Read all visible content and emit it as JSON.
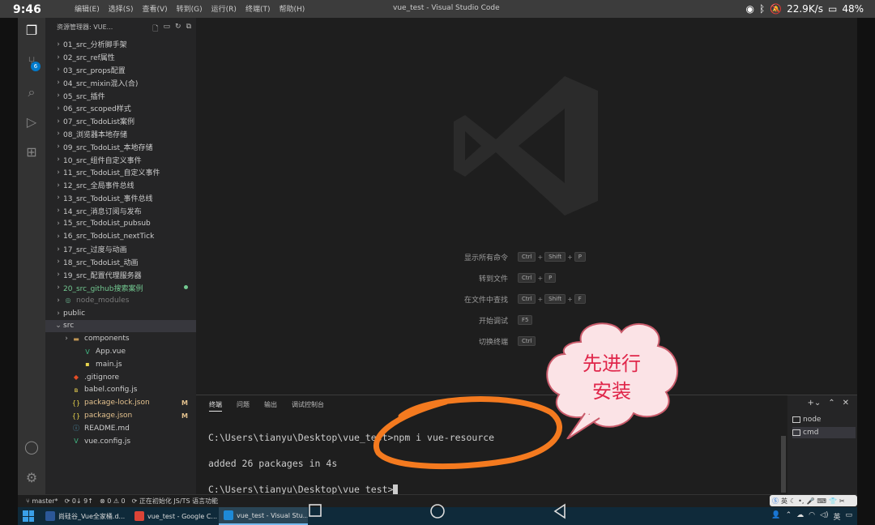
{
  "phone": {
    "time": "9:46",
    "network_speed": "22.9K/s",
    "battery": "48%"
  },
  "window": {
    "title": "vue_test - Visual Studio Code",
    "menus": [
      "编辑(E)",
      "选择(S)",
      "查看(V)",
      "转到(G)",
      "运行(R)",
      "终端(T)",
      "帮助(H)"
    ]
  },
  "activity_bar": {
    "scm_badge": "6"
  },
  "explorer": {
    "header": "资源管理器: VUE...",
    "items": [
      {
        "label": "01_src_分析脚手架",
        "type": "folder"
      },
      {
        "label": "02_src_ref属性",
        "type": "folder"
      },
      {
        "label": "03_src_props配置",
        "type": "folder"
      },
      {
        "label": "04_src_mixin混入(合)",
        "type": "folder"
      },
      {
        "label": "05_src_插件",
        "type": "folder"
      },
      {
        "label": "06_src_scoped样式",
        "type": "folder"
      },
      {
        "label": "07_src_TodoList案例",
        "type": "folder"
      },
      {
        "label": "08_浏览器本地存储",
        "type": "folder"
      },
      {
        "label": "09_src_TodoList_本地存储",
        "type": "folder"
      },
      {
        "label": "10_src_组件自定义事件",
        "type": "folder"
      },
      {
        "label": "11_src_TodoList_自定义事件",
        "type": "folder"
      },
      {
        "label": "12_src_全局事件总线",
        "type": "folder"
      },
      {
        "label": "13_src_TodoList_事件总线",
        "type": "folder"
      },
      {
        "label": "14_src_消息订阅与发布",
        "type": "folder"
      },
      {
        "label": "15_src_TodoList_pubsub",
        "type": "folder"
      },
      {
        "label": "16_src_TodoList_nextTick",
        "type": "folder"
      },
      {
        "label": "17_src_过度与动画",
        "type": "folder"
      },
      {
        "label": "18_src_TodoList_动画",
        "type": "folder"
      },
      {
        "label": "19_src_配置代理服务器",
        "type": "folder"
      },
      {
        "label": "20_src_github搜索案例",
        "type": "folder-modified"
      },
      {
        "label": "node_modules",
        "type": "folder-dim"
      },
      {
        "label": "public",
        "type": "folder"
      },
      {
        "label": "src",
        "type": "folder-open"
      },
      {
        "label": "components",
        "type": "subfolder"
      },
      {
        "label": "App.vue",
        "type": "vue"
      },
      {
        "label": "main.js",
        "type": "js"
      },
      {
        "label": ".gitignore",
        "type": "git"
      },
      {
        "label": "babel.config.js",
        "type": "babel"
      },
      {
        "label": "package-lock.json",
        "type": "json-m"
      },
      {
        "label": "package.json",
        "type": "json-m"
      },
      {
        "label": "README.md",
        "type": "md"
      },
      {
        "label": "vue.config.js",
        "type": "vuecfg"
      }
    ],
    "modified_mark": "M"
  },
  "welcome": {
    "shortcuts": [
      {
        "label": "显示所有命令",
        "keys": [
          "Ctrl",
          "Shift",
          "P"
        ]
      },
      {
        "label": "转到文件",
        "keys": [
          "Ctrl",
          "P"
        ]
      },
      {
        "label": "在文件中查找",
        "keys": [
          "Ctrl",
          "Shift",
          "F"
        ]
      },
      {
        "label": "开始调试",
        "keys": [
          "F5"
        ]
      },
      {
        "label": "切换终端",
        "keys": [
          "Ctrl"
        ]
      }
    ]
  },
  "panel": {
    "tabs": [
      "终端",
      "问题",
      "输出",
      "调试控制台"
    ],
    "terminal_lines": [
      "C:\\Users\\tianyu\\Desktop\\vue_test>npm i vue-resource",
      "added 26 packages in 4s",
      "C:\\Users\\tianyu\\Desktop\\vue_test>"
    ],
    "terminals": [
      "node",
      "cmd"
    ]
  },
  "annotation": {
    "line1": "先进行",
    "line2": "安装"
  },
  "status": {
    "branch": "master*",
    "sync": "0↓ 9↑",
    "problems": "⊗ 0 ⚠ 0",
    "message": "正在初始化 JS/TS 语言功能"
  },
  "ime": {
    "label": "英"
  },
  "taskbar": {
    "apps": [
      {
        "label": "尚硅谷_Vue全家桶.d...",
        "color": "#2b5797"
      },
      {
        "label": "vue_test - Google C...",
        "color": "#db4437"
      },
      {
        "label": "vue_test - Visual Stu...",
        "color": "#1e8ad6"
      }
    ],
    "tray_lang": "英"
  }
}
